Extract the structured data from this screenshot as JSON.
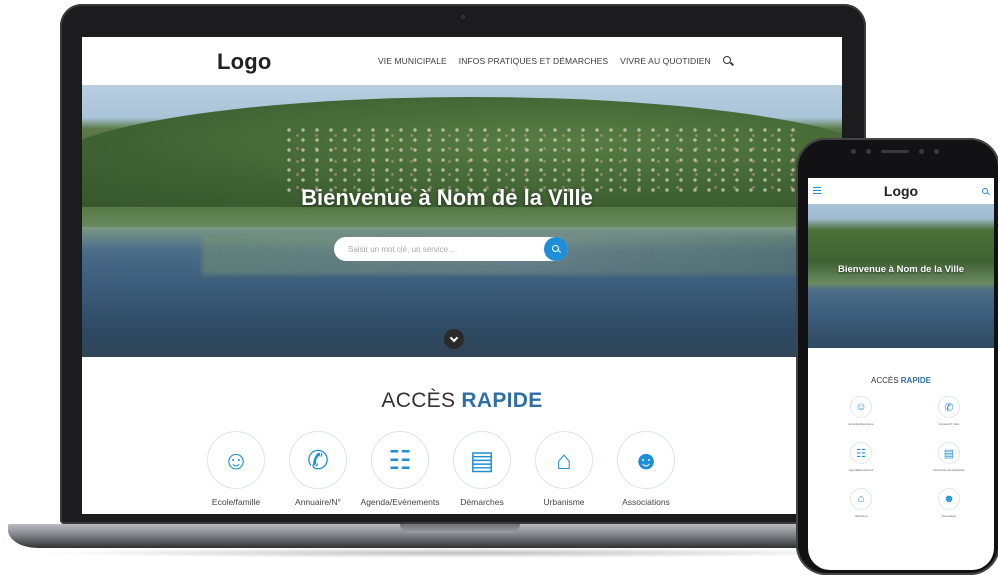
{
  "desktop": {
    "logo": "Logo",
    "nav": [
      "VIE MUNICIPALE",
      "INFOS PRATIQUES ET DÉMARCHES",
      "VIVRE AU QUOTIDIEN"
    ],
    "hero_title": "Bienvenue à Nom de la Ville",
    "search_placeholder": "Saisir un mot clé, un service ...",
    "quick_access": {
      "title": "ACCÈS",
      "title_accent": "RAPIDE"
    },
    "quick_items": [
      {
        "label": "Ecole/famille",
        "icon": "family-icon"
      },
      {
        "label": "Annuaire/N°",
        "icon": "phone-icon"
      },
      {
        "label": "Agenda/Evénements",
        "icon": "calendar-icon"
      },
      {
        "label": "Démarches",
        "icon": "clipboard-icon"
      },
      {
        "label": "Urbanisme",
        "icon": "house-plan-icon"
      },
      {
        "label": "Associations",
        "icon": "people-icon"
      }
    ]
  },
  "mobile": {
    "logo": "Logo",
    "hero_title": "Bienvenue à Nom de la Ville",
    "quick_access": {
      "title": "ACCÈS",
      "title_accent": "RAPIDE"
    },
    "quick_items": [
      {
        "label": "Ecole/famille/enfance",
        "icon": "family-icon"
      },
      {
        "label": "Annuaire/N° utiles",
        "icon": "phone-icon"
      },
      {
        "label": "Agenda/Evénements",
        "icon": "calendar-icon"
      },
      {
        "label": "Démarches administratives",
        "icon": "clipboard-icon"
      },
      {
        "label": "Urbanisme",
        "icon": "house-plan-icon"
      },
      {
        "label": "Associations",
        "icon": "people-icon"
      }
    ]
  },
  "colors": {
    "accent": "#1e8fd6",
    "title_accent": "#2f6fa6",
    "device": "#1c1c1e"
  }
}
